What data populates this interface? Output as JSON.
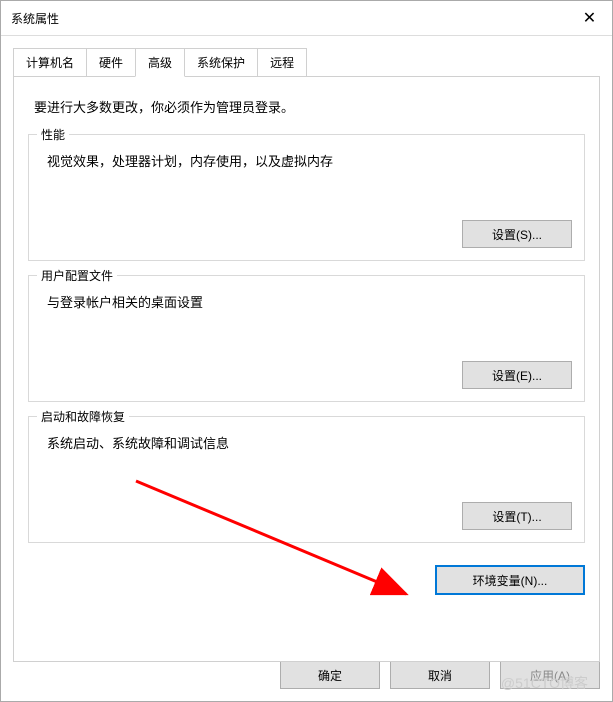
{
  "window": {
    "title": "系统属性"
  },
  "tabs": {
    "computer_name": "计算机名",
    "hardware": "硬件",
    "advanced": "高级",
    "system_protection": "系统保护",
    "remote": "远程"
  },
  "panel": {
    "intro": "要进行大多数更改，你必须作为管理员登录。",
    "performance": {
      "legend": "性能",
      "desc": "视觉效果，处理器计划，内存使用，以及虚拟内存",
      "button": "设置(S)..."
    },
    "user_profiles": {
      "legend": "用户配置文件",
      "desc": "与登录帐户相关的桌面设置",
      "button": "设置(E)..."
    },
    "startup_recovery": {
      "legend": "启动和故障恢复",
      "desc": "系统启动、系统故障和调试信息",
      "button": "设置(T)..."
    },
    "env_vars_button": "环境变量(N)..."
  },
  "dialog_buttons": {
    "ok": "确定",
    "cancel": "取消",
    "apply": "应用(A)"
  },
  "watermark": "@51CTO博客"
}
